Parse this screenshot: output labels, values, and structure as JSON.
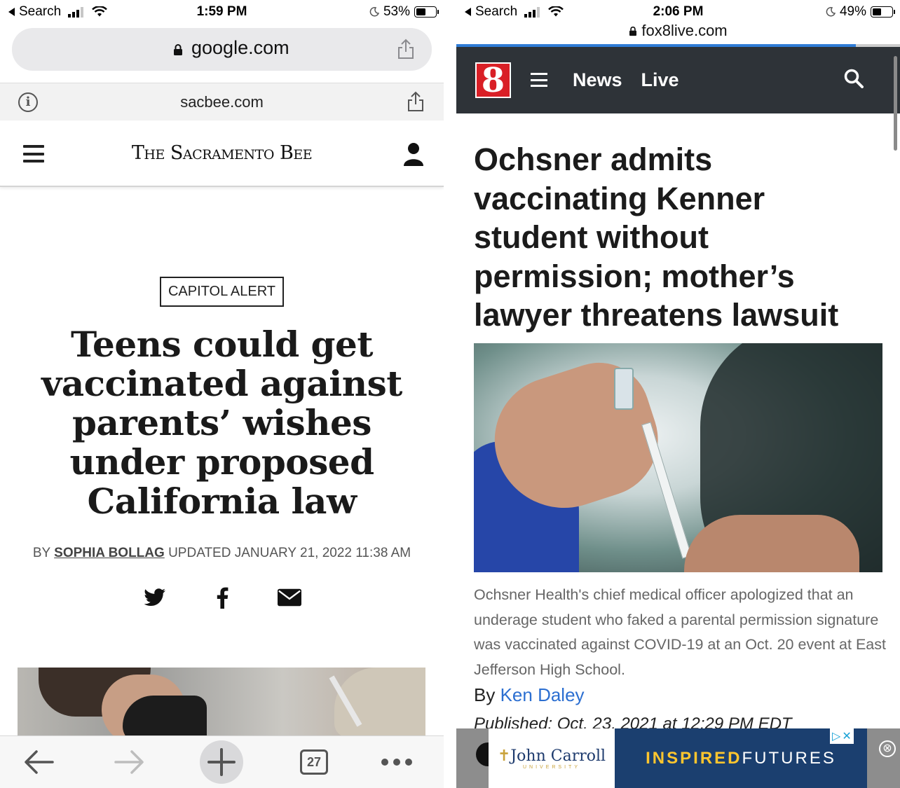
{
  "left": {
    "status": {
      "carrier": "Search",
      "time": "1:59 PM",
      "battery_percent": "53%",
      "battery_level": 0.53
    },
    "url_bar": {
      "domain": "google.com"
    },
    "sub_bar": {
      "domain": "sacbee.com"
    },
    "header": {
      "masthead": "The Sacramento Bee"
    },
    "article": {
      "kicker": "CAPITOL ALERT",
      "headline": "Teens could get vaccinated against parents’ wishes under proposed California law",
      "byline_prefix": "BY",
      "author": "SOPHIA BOLLAG",
      "updated": "UPDATED JANUARY 21, 2022 11:38 AM"
    },
    "share": {
      "icons": [
        "twitter-icon",
        "facebook-icon",
        "email-icon"
      ]
    },
    "toolbar": {
      "tab_count": "27",
      "icons": [
        "back-arrow-icon",
        "forward-arrow-icon",
        "plus-icon",
        "tabs-icon",
        "more-icon"
      ]
    }
  },
  "right": {
    "status": {
      "carrier": "Search",
      "time": "2:06 PM",
      "battery_percent": "49%",
      "battery_level": 0.49
    },
    "url_bar": {
      "domain": "fox8live.com",
      "load_progress": 0.9
    },
    "header": {
      "logo": "8",
      "nav": [
        "News",
        "Live"
      ]
    },
    "article": {
      "headline": "Ochsner admits vaccinating Kenner student without permission; mother’s lawyer threatens lawsuit",
      "caption": "Ochsner Health's chief medical officer apologized that an underage student who faked a parental permission signature was vaccinated against COVID-19 at an Oct. 20 event at East Jefferson High School.",
      "byline_prefix": "By",
      "author": "Ken Daley",
      "published": "Published: Oct. 23, 2021 at 12:29 PM EDT"
    },
    "ad": {
      "advertiser": "John Carroll",
      "advertiser_sub": "UNIVERSITY",
      "tagline_bold": "INSPIRED",
      "tagline_rest": "FUTURES",
      "close": "⊗"
    }
  },
  "colors": {
    "fox_header": "#2e3338",
    "fox_logo": "#d91f26",
    "link_blue": "#2c6fd1",
    "progress_blue": "#2f7cd6"
  }
}
